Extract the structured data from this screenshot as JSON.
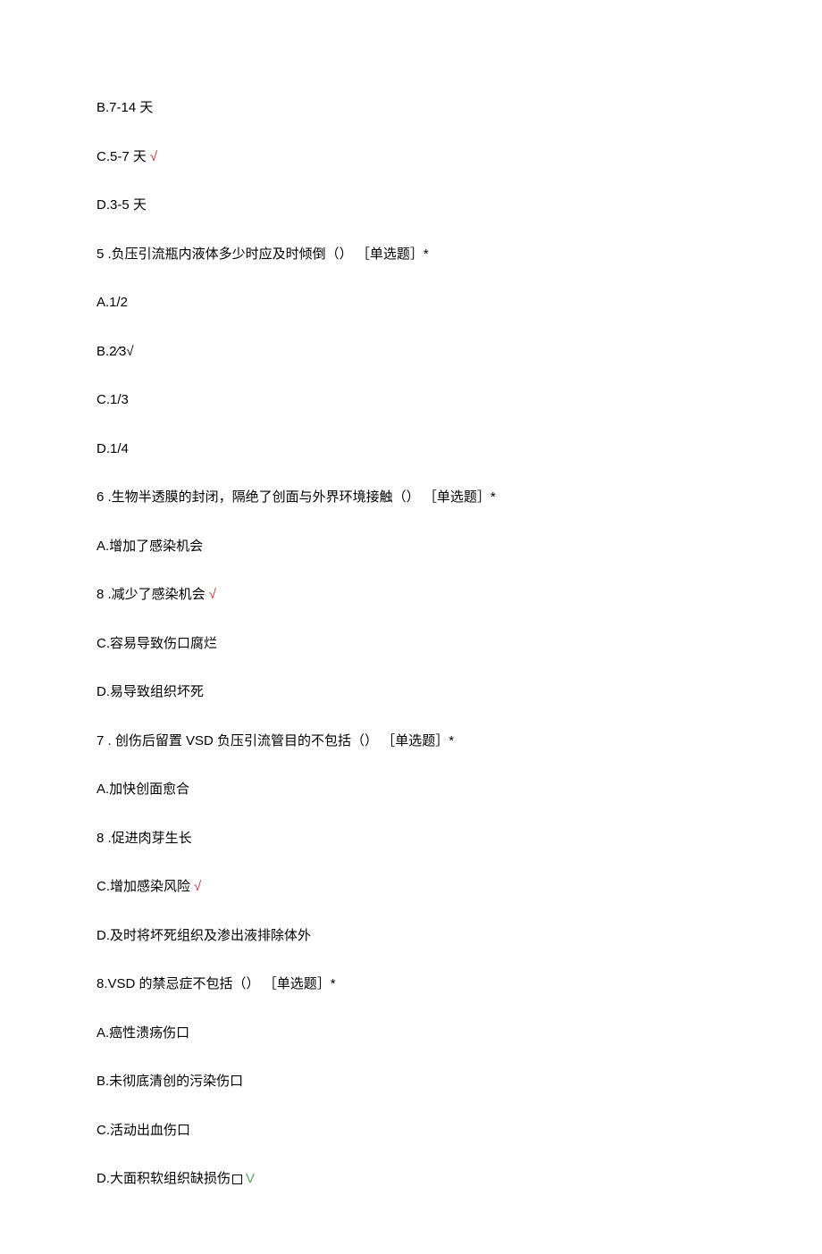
{
  "lines": [
    {
      "text": "B.7-14 天",
      "mark": null
    },
    {
      "text": "C.5-7 天",
      "mark": "red"
    },
    {
      "text": "D.3-5 天",
      "mark": null
    },
    {
      "text": "5  .负压引流瓶内液体多少时应及时倾倒（） ［单选题］*",
      "mark": null
    },
    {
      "text": "A.1/2",
      "mark": null
    },
    {
      "text": "B.2⁄3√",
      "mark": null
    },
    {
      "text": "C.1/3",
      "mark": null
    },
    {
      "text": "D.1/4",
      "mark": null
    },
    {
      "text": "6  .生物半透膜的封闭，隔绝了创面与外界环境接触（） ［单选题］*",
      "mark": null
    },
    {
      "text": "A.增加了感染机会",
      "mark": null
    },
    {
      "text": "8  .减少了感染机会",
      "mark": "red"
    },
    {
      "text": "C.容易导致伤口腐烂",
      "mark": null
    },
    {
      "text": "D.易导致组织坏死",
      "mark": null
    },
    {
      "text": "7  . 创伤后留置 VSD 负压引流管目的不包括（） ［单选题］*",
      "mark": null
    },
    {
      "text": "A.加快创面愈合",
      "mark": null
    },
    {
      "text": "8  .促进肉芽生长",
      "mark": null
    },
    {
      "text": "C.增加感染风险",
      "mark": "red"
    },
    {
      "text": "D.及时将坏死组织及渗出液排除体外",
      "mark": null
    },
    {
      "text": "8.VSD 的禁忌症不包括（） ［单选题］*",
      "mark": null
    },
    {
      "text": "A.癌性溃疡伤口",
      "mark": null
    },
    {
      "text": "B.未彻底清创的污染伤口",
      "mark": null
    },
    {
      "text": "C.活动出血伤口",
      "mark": null
    },
    {
      "text": "D.大面积软组织缺损伤",
      "mark": "square"
    }
  ],
  "marks": {
    "red": "√",
    "green": "V"
  }
}
